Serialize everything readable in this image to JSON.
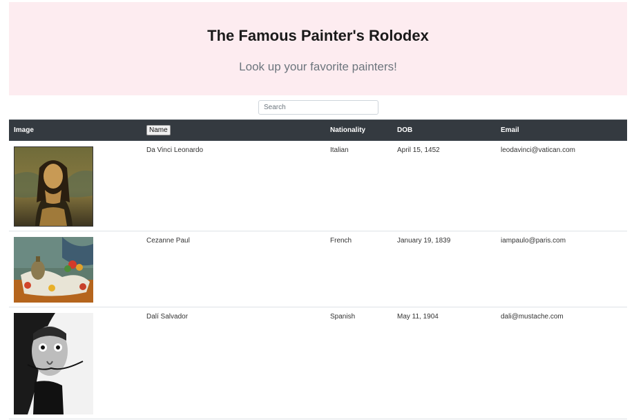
{
  "header": {
    "title": "The Famous Painter's Rolodex",
    "subtitle": "Look up your favorite painters!"
  },
  "search": {
    "placeholder": "Search",
    "value": ""
  },
  "table": {
    "columns": [
      "Image",
      "Name",
      "Nationality",
      "DOB",
      "Email"
    ],
    "rows": [
      {
        "image": "mona-lisa-painting",
        "name": "Da Vinci Leonardo",
        "nationality": "Italian",
        "dob": "April 15, 1452",
        "email": "leodavinci@vatican.com"
      },
      {
        "image": "still-life-painting",
        "name": "Cezanne Paul",
        "nationality": "French",
        "dob": "January 19, 1839",
        "email": "iampaulo@paris.com"
      },
      {
        "image": "dali-portrait-photo",
        "name": "Dalí Salvador",
        "nationality": "Spanish",
        "dob": "May 11, 1904",
        "email": "dali@mustache.com"
      }
    ]
  },
  "colors": {
    "hero_bg": "#fdecf0",
    "table_header_bg": "#343a40",
    "table_header_text": "#ffffff"
  }
}
